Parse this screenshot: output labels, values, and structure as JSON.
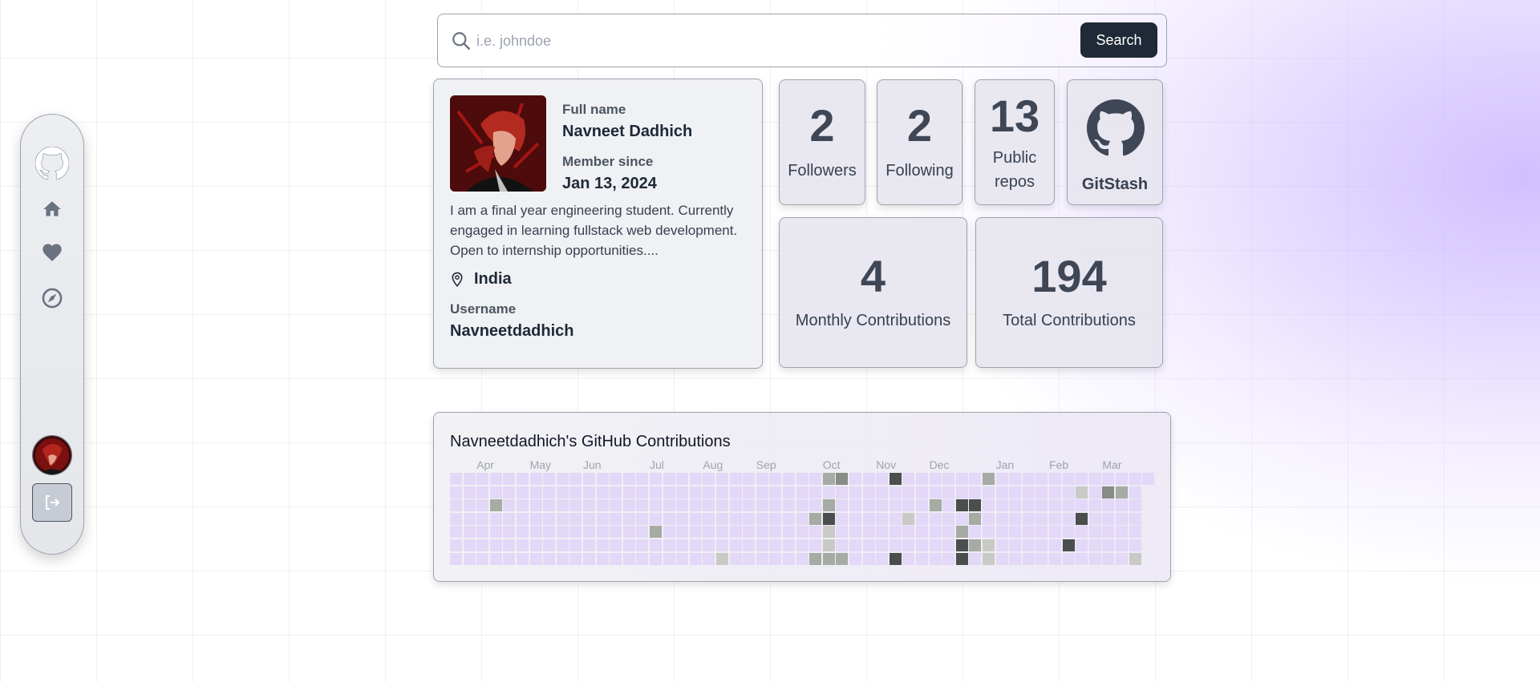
{
  "search": {
    "placeholder": "i.e. johndoe",
    "button_label": "Search"
  },
  "profile": {
    "full_name_label": "Full name",
    "full_name": "Navneet Dadhich",
    "member_since_label": "Member since",
    "member_since": "Jan 13, 2024",
    "bio": "I am a final year engineering student. Currently engaged in learning fullstack web development. Open to internship opportunities....",
    "location": "India",
    "username_label": "Username",
    "username": "Navneetdadhich"
  },
  "stats": {
    "followers": {
      "value": "2",
      "label": "Followers"
    },
    "following": {
      "value": "2",
      "label": "Following"
    },
    "public_repos": {
      "value": "13",
      "label_line1": "Public",
      "label_line2": "repos"
    },
    "brand": {
      "label": "GitStash",
      "icon": "github-icon"
    },
    "monthly": {
      "value": "4",
      "label": "Monthly Contributions"
    },
    "total": {
      "value": "194",
      "label": "Total Contributions"
    }
  },
  "contributions": {
    "title": "Navneetdadhich's GitHub Contributions",
    "months": [
      "Apr",
      "May",
      "Jun",
      "Jul",
      "Aug",
      "Sep",
      "Oct",
      "Nov",
      "Dec",
      "Jan",
      "Feb",
      "Mar"
    ],
    "weeks": 53,
    "cells": [
      {
        "w": 28,
        "d": 0,
        "level": 2
      },
      {
        "w": 29,
        "d": 0,
        "level": 3
      },
      {
        "w": 33,
        "d": 0,
        "level": 4
      },
      {
        "w": 40,
        "d": 0,
        "level": 2
      },
      {
        "w": 47,
        "d": 1,
        "level": 1
      },
      {
        "w": 49,
        "d": 1,
        "level": 3
      },
      {
        "w": 50,
        "d": 1,
        "level": 2
      },
      {
        "w": 3,
        "d": 2,
        "level": 2
      },
      {
        "w": 28,
        "d": 2,
        "level": 2
      },
      {
        "w": 36,
        "d": 2,
        "level": 2
      },
      {
        "w": 38,
        "d": 2,
        "level": 4
      },
      {
        "w": 39,
        "d": 2,
        "level": 4
      },
      {
        "w": 27,
        "d": 3,
        "level": 2
      },
      {
        "w": 28,
        "d": 3,
        "level": 4
      },
      {
        "w": 34,
        "d": 3,
        "level": 1
      },
      {
        "w": 39,
        "d": 3,
        "level": 2
      },
      {
        "w": 47,
        "d": 3,
        "level": 4
      },
      {
        "w": 15,
        "d": 4,
        "level": 2
      },
      {
        "w": 28,
        "d": 4,
        "level": 1
      },
      {
        "w": 38,
        "d": 4,
        "level": 2
      },
      {
        "w": 28,
        "d": 5,
        "level": 1
      },
      {
        "w": 38,
        "d": 5,
        "level": 4
      },
      {
        "w": 39,
        "d": 5,
        "level": 2
      },
      {
        "w": 40,
        "d": 5,
        "level": 1
      },
      {
        "w": 46,
        "d": 5,
        "level": 4
      },
      {
        "w": 20,
        "d": 6,
        "level": 1
      },
      {
        "w": 27,
        "d": 6,
        "level": 2
      },
      {
        "w": 28,
        "d": 6,
        "level": 2
      },
      {
        "w": 29,
        "d": 6,
        "level": 2
      },
      {
        "w": 33,
        "d": 6,
        "level": 4
      },
      {
        "w": 38,
        "d": 6,
        "level": 4
      },
      {
        "w": 40,
        "d": 6,
        "level": 1
      },
      {
        "w": 51,
        "d": 6,
        "level": 1
      }
    ],
    "colors": {
      "level_0": "#e3d8f7",
      "level_1": "#c9cac5",
      "level_2": "#a6aba3",
      "level_3": "#888c87",
      "level_4": "#4a4e4d"
    }
  },
  "sidebar": {
    "icons": [
      "github-logo-icon",
      "home-icon",
      "heart-icon",
      "compass-icon",
      "user-avatar",
      "logout-icon"
    ]
  }
}
